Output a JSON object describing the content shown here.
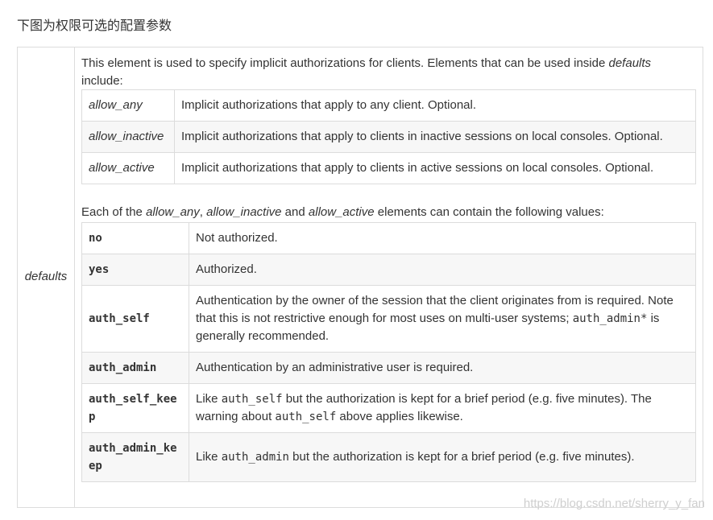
{
  "heading": "下图为权限可选的配置参数",
  "outer_label": "defaults",
  "intro": {
    "before": "This element is used to specify implicit authorizations for clients. Elements that can be used inside ",
    "em": "defaults",
    "after": " include:"
  },
  "elements_table": [
    {
      "key": "allow_any",
      "desc": "Implicit authorizations that apply to any client. Optional."
    },
    {
      "key": "allow_inactive",
      "desc": "Implicit authorizations that apply to clients in inactive sessions on local consoles. Optional."
    },
    {
      "key": "allow_active",
      "desc": "Implicit authorizations that apply to clients in active sessions on local consoles. Optional."
    }
  ],
  "mid": {
    "p1": "Each of the ",
    "e1": "allow_any",
    "p2": ", ",
    "e2": "allow_inactive",
    "p3": " and ",
    "e3": "allow_active",
    "p4": " elements can contain the following values:"
  },
  "values_table": {
    "no": {
      "key": "no",
      "desc": "Not authorized."
    },
    "yes": {
      "key": "yes",
      "desc": "Authorized."
    },
    "auth_self": {
      "key": "auth_self",
      "desc_before": "Authentication by the owner of the session that the client originates from is required. Note that this is not restrictive enough for most uses on multi-user systems; ",
      "code": "auth_admin*",
      "desc_after": " is generally recommended."
    },
    "auth_admin": {
      "key": "auth_admin",
      "desc": "Authentication by an administrative user is required."
    },
    "auth_self_keep": {
      "key_line1": "auth_self_kee",
      "key_line2": "p",
      "s1": "Like ",
      "c1": "auth_self",
      "s2": " but the authorization is kept for a brief period (e.g. five minutes). The warning about ",
      "c2": "auth_self",
      "s3": " above applies likewise."
    },
    "auth_admin_keep": {
      "key_line1": "auth_admin_ke",
      "key_line2": "ep",
      "s1": "Like ",
      "c1": "auth_admin",
      "s2": " but the authorization is kept for a brief period (e.g. five minutes)."
    }
  },
  "watermark": "https://blog.csdn.net/sherry_y_fan"
}
